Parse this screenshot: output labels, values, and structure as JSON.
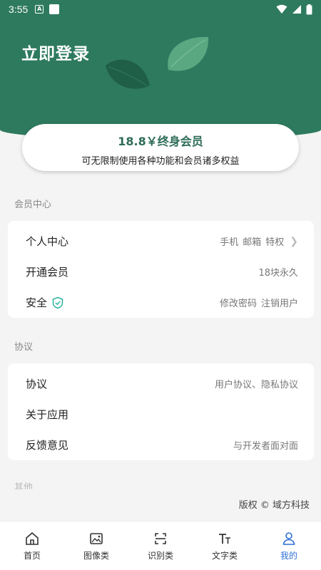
{
  "status_bar": {
    "time": "3:55",
    "note_icon_letter": "A"
  },
  "header": {
    "title": "立即登录"
  },
  "vip_card": {
    "price": "18.8￥终身会员",
    "desc": "可无限制使用各种功能和会员诸多权益"
  },
  "sections": {
    "member": {
      "title": "会员中心",
      "personal": {
        "label": "个人中心",
        "v1": "手机",
        "v2": "邮箱",
        "v3": "特权"
      },
      "vip": {
        "label": "开通会员",
        "value": "18块永久"
      },
      "security": {
        "label": "安全",
        "v1": "修改密码",
        "v2": "注销用户"
      }
    },
    "agreement": {
      "title": "协议",
      "protocol": {
        "label": "协议",
        "value": "用户协议、隐私协议"
      },
      "about": {
        "label": "关于应用"
      },
      "feedback": {
        "label": "反馈意见",
        "value": "与开发者面对面"
      }
    },
    "other": {
      "title": "其他"
    }
  },
  "copyright": "版权 © 域方科技",
  "nav": {
    "home": "首页",
    "image": "图像类",
    "recognize": "识别类",
    "text": "文字类",
    "mine": "我的"
  },
  "colors": {
    "header": "#2e7a5f",
    "accent": "#2f6fd6",
    "shield": "#2bb3a0"
  }
}
